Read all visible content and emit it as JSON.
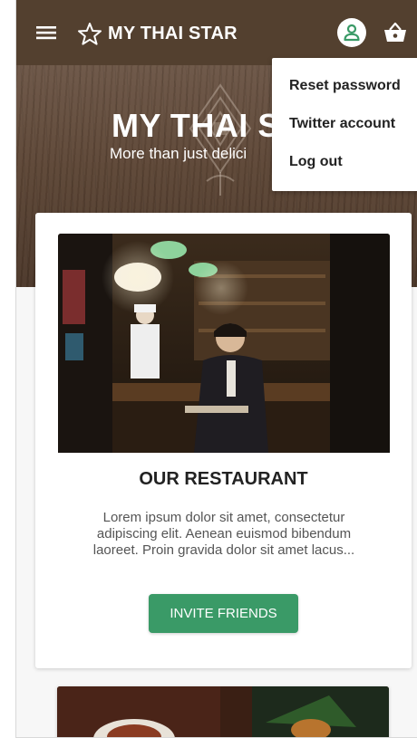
{
  "header": {
    "title": "MY THAI STAR",
    "menu_icon": "hamburger-menu-icon",
    "favorite_icon": "star-outline-icon",
    "account_icon": "account-icon",
    "cart_icon": "shopping-basket-icon"
  },
  "hero": {
    "title": "MY THAI S",
    "subtitle": "More than just delici"
  },
  "user_menu": {
    "items": [
      {
        "label": "Reset password"
      },
      {
        "label": "Twitter account"
      },
      {
        "label": "Log out"
      }
    ]
  },
  "restaurant_card": {
    "title": "OUR RESTAURANT",
    "description": "Lorem ipsum dolor sit amet, consectetur adipiscing elit. Aenean euismod bibendum laoreet. Proin gravida dolor sit amet lacus...",
    "button_label": "INVITE FRIENDS"
  },
  "colors": {
    "header_bg": "#53402f",
    "accent_green": "#3a9a67",
    "card_bg": "#ffffff"
  }
}
